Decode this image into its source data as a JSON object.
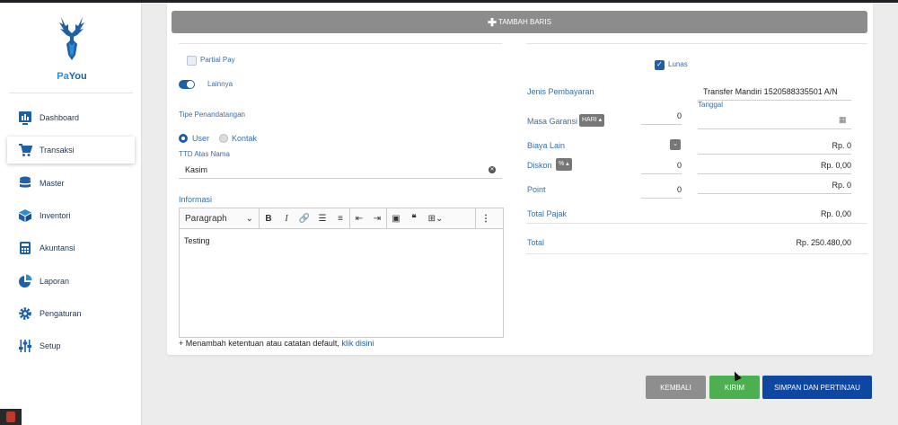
{
  "app": {
    "name_part1": "Pa",
    "name_part2": "You"
  },
  "sidebar": {
    "items": [
      {
        "label": "Dashboard",
        "icon": "dashboard-icon"
      },
      {
        "label": "Transaksi",
        "icon": "cart-icon"
      },
      {
        "label": "Master",
        "icon": "database-icon"
      },
      {
        "label": "Inventori",
        "icon": "box-icon"
      },
      {
        "label": "Akuntansi",
        "icon": "calculator-icon"
      },
      {
        "label": "Laporan",
        "icon": "pie-chart-icon"
      },
      {
        "label": "Pengaturan",
        "icon": "gear-icon"
      },
      {
        "label": "Setup",
        "icon": "sliders-icon"
      }
    ]
  },
  "form": {
    "add_row_label": "TAMBAH BARIS",
    "partial_pay_label": "Partial Pay",
    "lainnya_label": "Lainnya",
    "lunas_label": "Lunas",
    "tipe_penandatangan_label": "Tipe Penandatangan",
    "radio_user": "User",
    "radio_kontak": "Kontak",
    "ttd_label": "TTD Atas Nama",
    "ttd_value": "Kasim",
    "informasi_label": "Informasi",
    "editor": {
      "paragraph": "Paragraph",
      "content": "Testing"
    },
    "footnote_text": "+ Menambah ketentuan atau catatan default,",
    "footnote_link": "klik disini"
  },
  "payment": {
    "jenis_label": "Jenis Pembayaran",
    "jenis_value": "Transfer Mandiri 1520588335501 A/N",
    "tanggal_label": "Tanggal",
    "masa_garansi_label": "Masa Garansi",
    "garansi_unit": "HARI",
    "garansi_value": "0",
    "biaya_lain_label": "Biaya Lain",
    "biaya_lain_value": "Rp. 0",
    "diskon_label": "Diskon",
    "diskon_unit": "%",
    "diskon_value": "0",
    "diskon_rp": "Rp. 0,00",
    "point_label": "Point",
    "point_value": "0",
    "point_rp": "Rp. 0",
    "total_pajak_label": "Total Pajak",
    "total_pajak_value": "Rp. 0,00",
    "total_label": "Total",
    "total_value": "Rp. 250.480,00"
  },
  "actions": {
    "kembali": "KEMBALI",
    "kirim": "KIRIM",
    "simpan": "SIMPAN DAN PERTINJAU"
  },
  "colors": {
    "primary": "#1f5fa8",
    "kembali": "#8e8e8e",
    "kirim": "#4caf50",
    "simpan": "#0d47a1",
    "add_row": "#8c8c8c"
  }
}
